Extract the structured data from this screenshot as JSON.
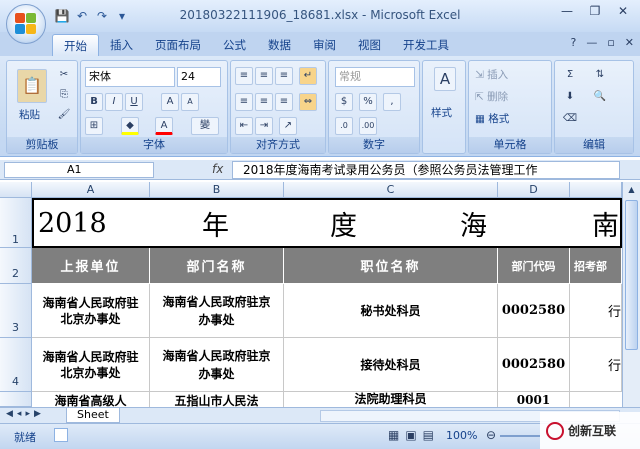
{
  "window": {
    "title": "20180322111906_18681.xlsx - Microsoft Excel"
  },
  "tabs": [
    "开始",
    "插入",
    "页面布局",
    "公式",
    "数据",
    "审阅",
    "视图",
    "开发工具"
  ],
  "ribbon": {
    "clipboard": {
      "paste": "粘贴",
      "label": "剪贴板"
    },
    "font": {
      "name": "宋体",
      "size": "24",
      "label": "字体"
    },
    "alignment": {
      "label": "对齐方式"
    },
    "number": {
      "format": "常规",
      "label": "数字"
    },
    "styles": {
      "button": "样式"
    },
    "cells": {
      "insert": "插入",
      "delete": "删除",
      "format": "格式",
      "label": "单元格"
    },
    "editing": {
      "label": "编辑"
    }
  },
  "formula_bar": {
    "name_box": "A1",
    "fx": "fx",
    "value": "2018年度海南考试录用公务员（参照公务员法管理工作"
  },
  "columns": [
    "A",
    "B",
    "C",
    "D"
  ],
  "rows": [
    "1",
    "2",
    "3",
    "4"
  ],
  "title_row": [
    "2018",
    "年",
    "度",
    "海",
    "南"
  ],
  "headers": [
    "上报单位",
    "部门名称",
    "职位名称",
    "部门代码",
    "招考部"
  ],
  "data": [
    {
      "a": "海南省人民政府驻北京办事处",
      "b": "海南省人民政府驻京办事处",
      "c": "秘书处科员",
      "d": "0002580",
      "e": "行"
    },
    {
      "a": "海南省人民政府驻北京办事处",
      "b": "海南省人民政府驻京办事处",
      "c": "接待处科员",
      "d": "0002580",
      "e": "行"
    },
    {
      "a": "海南省高级人",
      "b": "五指山市人民法",
      "c": "法院助理科员",
      "d": "0001",
      "e": ""
    }
  ],
  "sheet_tab": "Sheet",
  "status": {
    "ready": "就绪",
    "zoom": "100%"
  },
  "watermark": "创新互联"
}
